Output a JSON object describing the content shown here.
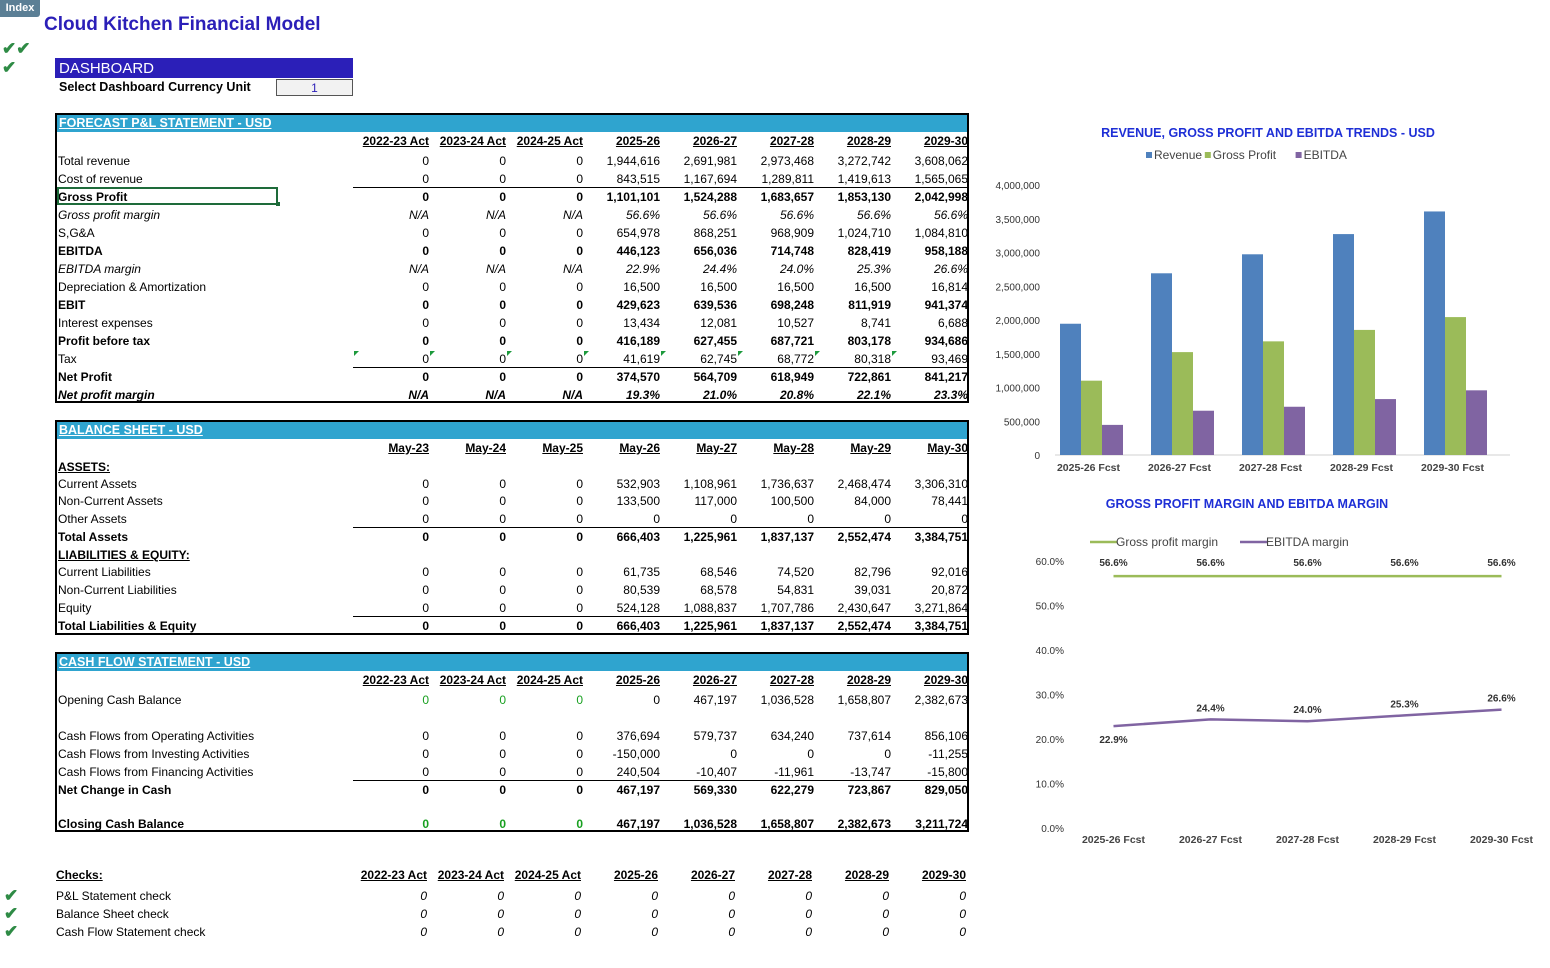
{
  "index_tab": "Index",
  "title": "Cloud Kitchen Financial Model",
  "dashboard": {
    "header": "DASHBOARD",
    "currency_label": "Select Dashboard Currency Unit",
    "currency_value": "1"
  },
  "pl": {
    "header": "FORECAST P&L STATEMENT - USD",
    "columns": [
      "2022-23 Act",
      "2023-24 Act",
      "2024-25 Act",
      "2025-26",
      "2026-27",
      "2027-28",
      "2028-29",
      "2029-30"
    ],
    "rows": [
      {
        "label": "Total revenue",
        "values": [
          "0",
          "0",
          "0",
          "1,944,616",
          "2,691,981",
          "2,973,468",
          "3,272,742",
          "3,608,062"
        ]
      },
      {
        "label": "Cost of revenue",
        "values": [
          "0",
          "0",
          "0",
          "843,515",
          "1,167,694",
          "1,289,811",
          "1,419,613",
          "1,565,065"
        ]
      },
      {
        "label": "Gross Profit",
        "values": [
          "0",
          "0",
          "0",
          "1,101,101",
          "1,524,288",
          "1,683,657",
          "1,853,130",
          "2,042,998"
        ]
      },
      {
        "label": "Gross profit margin",
        "values": [
          "N/A",
          "N/A",
          "N/A",
          "56.6%",
          "56.6%",
          "56.6%",
          "56.6%",
          "56.6%"
        ]
      },
      {
        "label": "S,G&A",
        "values": [
          "0",
          "0",
          "0",
          "654,978",
          "868,251",
          "968,909",
          "1,024,710",
          "1,084,810"
        ]
      },
      {
        "label": "EBITDA",
        "values": [
          "0",
          "0",
          "0",
          "446,123",
          "656,036",
          "714,748",
          "828,419",
          "958,188"
        ]
      },
      {
        "label": "EBITDA margin",
        "values": [
          "N/A",
          "N/A",
          "N/A",
          "22.9%",
          "24.4%",
          "24.0%",
          "25.3%",
          "26.6%"
        ]
      },
      {
        "label": "Depreciation & Amortization",
        "values": [
          "0",
          "0",
          "0",
          "16,500",
          "16,500",
          "16,500",
          "16,500",
          "16,814"
        ]
      },
      {
        "label": "EBIT",
        "values": [
          "0",
          "0",
          "0",
          "429,623",
          "639,536",
          "698,248",
          "811,919",
          "941,374"
        ]
      },
      {
        "label": "Interest expenses",
        "values": [
          "0",
          "0",
          "0",
          "13,434",
          "12,081",
          "10,527",
          "8,741",
          "6,688"
        ]
      },
      {
        "label": "Profit before tax",
        "values": [
          "0",
          "0",
          "0",
          "416,189",
          "627,455",
          "687,721",
          "803,178",
          "934,686"
        ]
      },
      {
        "label": "Tax",
        "values": [
          "0",
          "0",
          "0",
          "41,619",
          "62,745",
          "68,772",
          "80,318",
          "93,469"
        ]
      },
      {
        "label": "Net Profit",
        "values": [
          "0",
          "0",
          "0",
          "374,570",
          "564,709",
          "618,949",
          "722,861",
          "841,217"
        ]
      },
      {
        "label": "Net profit margin",
        "values": [
          "N/A",
          "N/A",
          "N/A",
          "19.3%",
          "21.0%",
          "20.8%",
          "22.1%",
          "23.3%"
        ]
      }
    ]
  },
  "bs": {
    "header": "BALANCE SHEET - USD",
    "columns": [
      "May-23",
      "May-24",
      "May-25",
      "May-26",
      "May-27",
      "May-28",
      "May-29",
      "May-30"
    ],
    "rows": [
      {
        "label": "ASSETS:",
        "values": [
          "",
          "",
          "",
          "",
          "",
          "",
          "",
          ""
        ]
      },
      {
        "label": "Current Assets",
        "values": [
          "0",
          "0",
          "0",
          "532,903",
          "1,108,961",
          "1,736,637",
          "2,468,474",
          "3,306,310"
        ]
      },
      {
        "label": "Non-Current Assets",
        "values": [
          "0",
          "0",
          "0",
          "133,500",
          "117,000",
          "100,500",
          "84,000",
          "78,441"
        ]
      },
      {
        "label": "Other Assets",
        "values": [
          "0",
          "0",
          "0",
          "0",
          "0",
          "0",
          "0",
          "0"
        ]
      },
      {
        "label": "Total Assets",
        "values": [
          "0",
          "0",
          "0",
          "666,403",
          "1,225,961",
          "1,837,137",
          "2,552,474",
          "3,384,751"
        ]
      },
      {
        "label": "LIABILITIES & EQUITY:",
        "values": [
          "",
          "",
          "",
          "",
          "",
          "",
          "",
          ""
        ]
      },
      {
        "label": "Current Liabilities",
        "values": [
          "0",
          "0",
          "0",
          "61,735",
          "68,546",
          "74,520",
          "82,796",
          "92,016"
        ]
      },
      {
        "label": "Non-Current Liabilities",
        "values": [
          "0",
          "0",
          "0",
          "80,539",
          "68,578",
          "54,831",
          "39,031",
          "20,872"
        ]
      },
      {
        "label": "Equity",
        "values": [
          "0",
          "0",
          "0",
          "524,128",
          "1,088,837",
          "1,707,786",
          "2,430,647",
          "3,271,864"
        ]
      },
      {
        "label": "Total Liabilities & Equity",
        "values": [
          "0",
          "0",
          "0",
          "666,403",
          "1,225,961",
          "1,837,137",
          "2,552,474",
          "3,384,751"
        ]
      }
    ]
  },
  "cf": {
    "header": "CASH FLOW STATEMENT -  USD",
    "columns": [
      "2022-23 Act",
      "2023-24 Act",
      "2024-25 Act",
      "2025-26",
      "2026-27",
      "2027-28",
      "2028-29",
      "2029-30"
    ],
    "rows": [
      {
        "label": "Opening Cash Balance",
        "values": [
          "0",
          "0",
          "0",
          "0",
          "467,197",
          "1,036,528",
          "1,658,807",
          "2,382,673"
        ]
      },
      {
        "label": "Cash Flows from Operating Activities",
        "values": [
          "0",
          "0",
          "0",
          "376,694",
          "579,737",
          "634,240",
          "737,614",
          "856,106"
        ]
      },
      {
        "label": "Cash Flows from Investing Activities",
        "values": [
          "0",
          "0",
          "0",
          "-150,000",
          "0",
          "0",
          "0",
          "-11,255"
        ]
      },
      {
        "label": "Cash Flows from Financing Activities",
        "values": [
          "0",
          "0",
          "0",
          "240,504",
          "-10,407",
          "-11,961",
          "-13,747",
          "-15,800"
        ]
      },
      {
        "label": "Net Change in Cash",
        "values": [
          "0",
          "0",
          "0",
          "467,197",
          "569,330",
          "622,279",
          "723,867",
          "829,050"
        ]
      },
      {
        "label": "Closing Cash Balance",
        "values": [
          "0",
          "0",
          "0",
          "467,197",
          "1,036,528",
          "1,658,807",
          "2,382,673",
          "3,211,724"
        ]
      }
    ]
  },
  "checks": {
    "header": "Checks:",
    "columns": [
      "2022-23 Act",
      "2023-24 Act",
      "2024-25 Act",
      "2025-26",
      "2026-27",
      "2027-28",
      "2028-29",
      "2029-30"
    ],
    "rows": [
      {
        "label": "P&L Statement check",
        "values": [
          "0",
          "0",
          "0",
          "0",
          "0",
          "0",
          "0",
          "0"
        ]
      },
      {
        "label": "Balance Sheet check",
        "values": [
          "0",
          "0",
          "0",
          "0",
          "0",
          "0",
          "0",
          "0"
        ]
      },
      {
        "label": "Cash Flow Statement check",
        "values": [
          "0",
          "0",
          "0",
          "0",
          "0",
          "0",
          "0",
          "0"
        ]
      }
    ]
  },
  "colors": {
    "title": "#2b1fb8",
    "section_header": "#2fa4cf",
    "revenue": "#4f81bd",
    "gross_profit": "#9bbb59",
    "ebitda": "#8064a2",
    "check": "#2e8b45"
  },
  "chart_data": [
    {
      "type": "bar",
      "title": "REVENUE, GROSS PROFIT AND EBITDA TRENDS - USD",
      "categories": [
        "2025-26 Fcst",
        "2026-27 Fcst",
        "2027-28 Fcst",
        "2028-29 Fcst",
        "2029-30 Fcst"
      ],
      "series": [
        {
          "name": "Revenue",
          "values": [
            1944616,
            2691981,
            2973468,
            3272742,
            3608062
          ]
        },
        {
          "name": "Gross Profit",
          "values": [
            1101101,
            1524288,
            1683657,
            1853130,
            2042998
          ]
        },
        {
          "name": "EBITDA",
          "values": [
            446123,
            656036,
            714748,
            828419,
            958188
          ]
        }
      ],
      "yticks": [
        "0",
        "500,000",
        "1,000,000",
        "1,500,000",
        "2,000,000",
        "2,500,000",
        "3,000,000",
        "3,500,000",
        "4,000,000"
      ],
      "ylim": [
        0,
        4000000
      ],
      "legend": "top"
    },
    {
      "type": "line",
      "title": "GROSS PROFIT MARGIN AND EBITDA MARGIN",
      "categories": [
        "2025-26 Fcst",
        "2026-27 Fcst",
        "2027-28 Fcst",
        "2028-29 Fcst",
        "2029-30 Fcst"
      ],
      "series": [
        {
          "name": "Gross profit margin",
          "values": [
            56.6,
            56.6,
            56.6,
            56.6,
            56.6
          ],
          "labels": [
            "56.6%",
            "56.6%",
            "56.6%",
            "56.6%",
            "56.6%"
          ]
        },
        {
          "name": "EBITDA margin",
          "values": [
            22.9,
            24.4,
            24.0,
            25.3,
            26.6
          ],
          "labels": [
            "22.9%",
            "24.4%",
            "24.0%",
            "25.3%",
            "26.6%"
          ]
        }
      ],
      "yticks": [
        "0.0%",
        "10.0%",
        "20.0%",
        "30.0%",
        "40.0%",
        "50.0%",
        "60.0%"
      ],
      "ylim": [
        0,
        60
      ],
      "legend": "top"
    }
  ]
}
